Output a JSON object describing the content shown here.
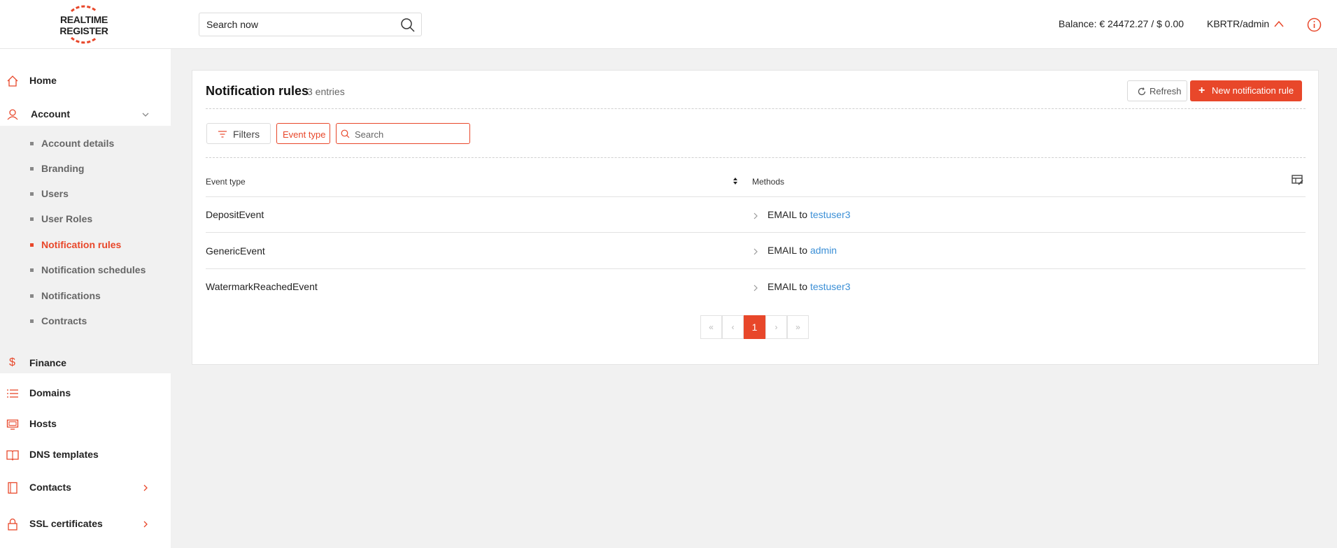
{
  "header": {
    "logo_text": "REALTIME REGISTER",
    "logo_line1": "REALTIME",
    "logo_line2": "REGISTER",
    "search_placeholder": "Search now",
    "balance": "Balance: € 24472.27 / $ 0.00",
    "user": "KBRTR/admin"
  },
  "sidebar": {
    "home": "Home",
    "account": "Account",
    "account_items": [
      {
        "label": "Account details",
        "active": false
      },
      {
        "label": "Branding",
        "active": false
      },
      {
        "label": "Users",
        "active": false
      },
      {
        "label": "User Roles",
        "active": false
      },
      {
        "label": "Notification rules",
        "active": true
      },
      {
        "label": "Notification schedules",
        "active": false
      },
      {
        "label": "Notifications",
        "active": false
      },
      {
        "label": "Contracts",
        "active": false
      }
    ],
    "finance": "Finance",
    "domains": "Domains",
    "hosts": "Hosts",
    "dns_templates": "DNS templates",
    "contacts": "Contacts",
    "ssl_certificates": "SSL certificates"
  },
  "main": {
    "title": "Notification rules",
    "count": "3 entries",
    "refresh_label": "Refresh",
    "new_label": "New notification rule",
    "filters_label": "Filters",
    "event_type_chip": "Event type",
    "filter_search_placeholder": "Search",
    "columns": {
      "event_type": "Event type",
      "methods": "Methods"
    },
    "rows": [
      {
        "event": "DepositEvent",
        "method": "EMAIL to",
        "target": "testuser3"
      },
      {
        "event": "GenericEvent",
        "method": "EMAIL to",
        "target": "admin"
      },
      {
        "event": "WatermarkReachedEvent",
        "method": "EMAIL to",
        "target": "testuser3"
      }
    ],
    "pagination": {
      "first": "«",
      "prev": "‹",
      "current": "1",
      "next": "›",
      "last": "»"
    }
  },
  "colors": {
    "accent": "#e8472a",
    "link": "#3b8fd6",
    "background": "#f1f1f1"
  }
}
